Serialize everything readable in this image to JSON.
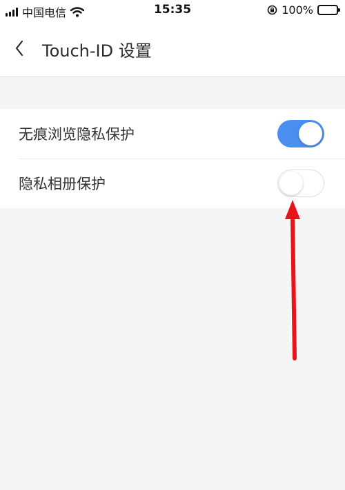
{
  "status_bar": {
    "carrier": "中国电信",
    "time": "15:35",
    "battery": "100%",
    "icons": [
      "signal-icon",
      "wifi-icon",
      "rotation-lock-icon",
      "battery-charging-icon"
    ]
  },
  "nav": {
    "title": "Touch-ID 设置",
    "back_icon": "chevron-left-icon"
  },
  "settings": {
    "items": [
      {
        "label": "无痕浏览隐私保护",
        "enabled": true
      },
      {
        "label": "隐私相册保护",
        "enabled": false
      }
    ]
  },
  "colors": {
    "toggle_on": "#4a8ef0",
    "background": "#f5f5f5",
    "annotation_arrow": "#e8131b"
  }
}
